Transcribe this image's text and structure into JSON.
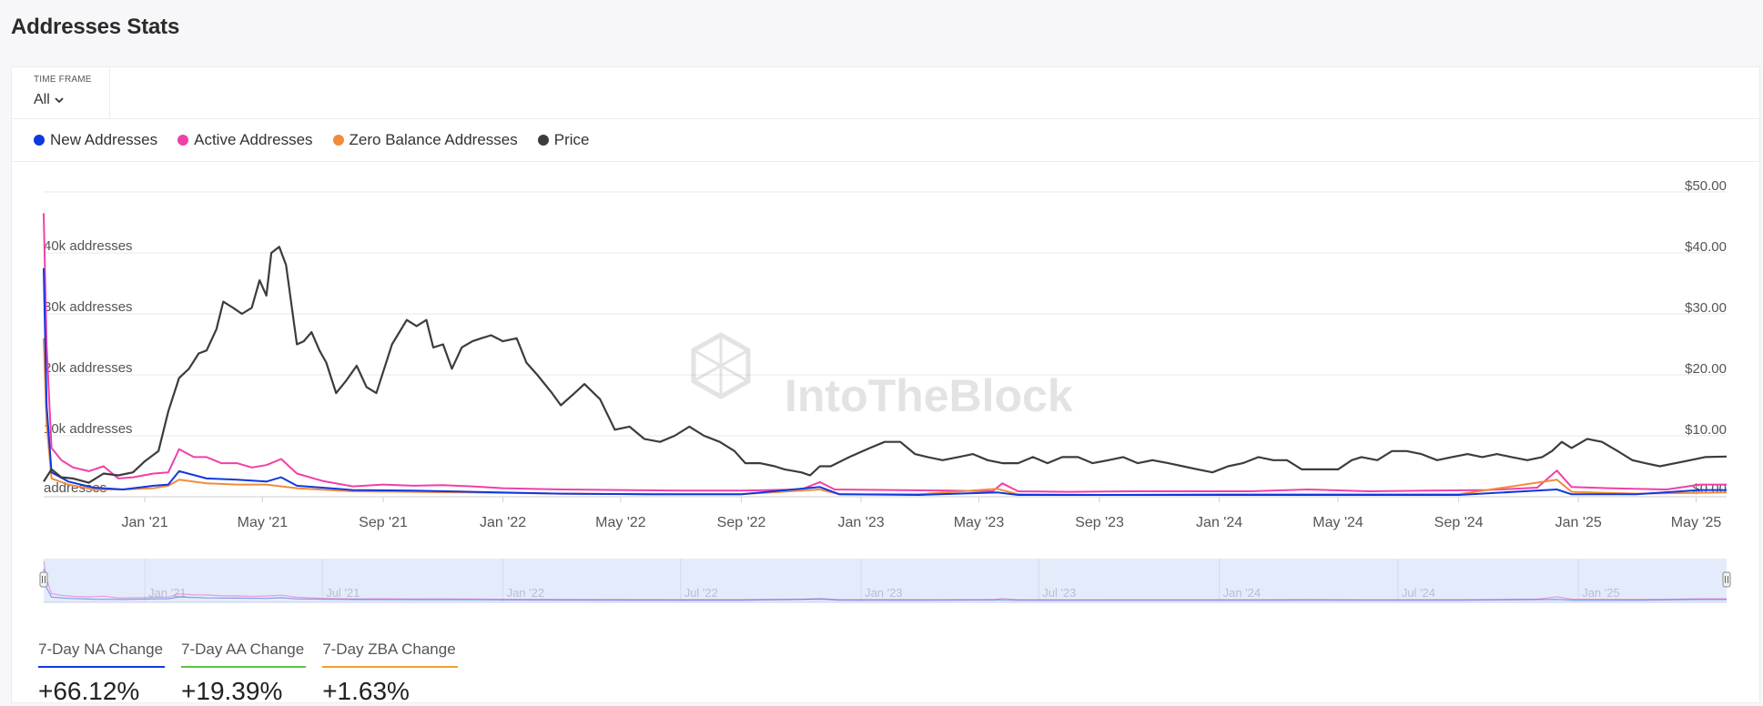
{
  "page": {
    "title": "Addresses Stats"
  },
  "timeframe": {
    "label": "TIME FRAME",
    "value": "All"
  },
  "legend": [
    {
      "label": "New Addresses",
      "color": "#1038e0"
    },
    {
      "label": "Active Addresses",
      "color": "#f040a8"
    },
    {
      "label": "Zero Balance Addresses",
      "color": "#f08c3c"
    },
    {
      "label": "Price",
      "color": "#3c3c3c"
    }
  ],
  "watermark": "IntoTheBlock",
  "navigator": {
    "labels": [
      "Jan '21",
      "Jul '21",
      "Jan '22",
      "Jul '22",
      "Jan '23",
      "Jul '23",
      "Jan '24",
      "Jul '24",
      "Jan '25"
    ]
  },
  "stats": [
    {
      "label": "7-Day NA Change",
      "value": "+66.12%",
      "color": "#1038e0"
    },
    {
      "label": "7-Day AA Change",
      "value": "+19.39%",
      "color": "#5cc24a"
    },
    {
      "label": "7-Day ZBA Change",
      "value": "+1.63%",
      "color": "#f0a030"
    }
  ],
  "chart_data": {
    "type": "line",
    "x_tick_labels": [
      "Jan '21",
      "May '21",
      "Sep '21",
      "Jan '22",
      "May '22",
      "Sep '22",
      "Jan '23",
      "May '23",
      "Sep '23",
      "Jan '24",
      "May '24",
      "Sep '24",
      "Jan '25",
      "May '25"
    ],
    "y_left_tick_labels": [
      "addresses",
      "10k addresses",
      "20k addresses",
      "30k addresses",
      "40k addresses"
    ],
    "y_left_range": [
      0,
      45000
    ],
    "y_right_tick_labels": [
      "$0.00",
      "$10.00",
      "$20.00",
      "$30.00",
      "$40.00",
      "$50.00"
    ],
    "y_right_range": [
      0,
      50
    ],
    "x_range": [
      "2020-09-20",
      "2025-06-01"
    ],
    "grid": true,
    "legend_position": "top-left",
    "series": [
      {
        "name": "Price",
        "axis": "right",
        "color": "#3c3c3c",
        "points": [
          [
            "2020-09-20",
            2.5
          ],
          [
            "2020-09-28",
            4.5
          ],
          [
            "2020-10-08",
            3.2
          ],
          [
            "2020-10-20",
            3.0
          ],
          [
            "2020-11-05",
            2.3
          ],
          [
            "2020-11-20",
            3.8
          ],
          [
            "2020-12-05",
            3.5
          ],
          [
            "2020-12-20",
            4.0
          ],
          [
            "2021-01-01",
            5.8
          ],
          [
            "2021-01-15",
            7.5
          ],
          [
            "2021-01-25",
            14.0
          ],
          [
            "2021-02-05",
            19.5
          ],
          [
            "2021-02-15",
            21.0
          ],
          [
            "2021-02-25",
            23.5
          ],
          [
            "2021-03-05",
            24.0
          ],
          [
            "2021-03-15",
            27.5
          ],
          [
            "2021-03-22",
            32.0
          ],
          [
            "2021-04-01",
            31.0
          ],
          [
            "2021-04-10",
            30.0
          ],
          [
            "2021-04-20",
            31.0
          ],
          [
            "2021-04-28",
            35.5
          ],
          [
            "2021-05-05",
            33.0
          ],
          [
            "2021-05-10",
            40.0
          ],
          [
            "2021-05-18",
            41.0
          ],
          [
            "2021-05-25",
            38.0
          ],
          [
            "2021-06-05",
            25.0
          ],
          [
            "2021-06-12",
            25.5
          ],
          [
            "2021-06-20",
            27.0
          ],
          [
            "2021-06-28",
            24.0
          ],
          [
            "2021-07-05",
            22.0
          ],
          [
            "2021-07-15",
            17.0
          ],
          [
            "2021-07-25",
            19.0
          ],
          [
            "2021-08-05",
            21.5
          ],
          [
            "2021-08-15",
            18.0
          ],
          [
            "2021-08-25",
            17.0
          ],
          [
            "2021-09-10",
            25.0
          ],
          [
            "2021-09-25",
            29.0
          ],
          [
            "2021-10-05",
            28.0
          ],
          [
            "2021-10-15",
            29.0
          ],
          [
            "2021-10-22",
            24.5
          ],
          [
            "2021-11-01",
            25.0
          ],
          [
            "2021-11-10",
            21.0
          ],
          [
            "2021-11-20",
            24.5
          ],
          [
            "2021-12-01",
            25.5
          ],
          [
            "2021-12-10",
            26.0
          ],
          [
            "2021-12-20",
            26.5
          ],
          [
            "2022-01-01",
            25.5
          ],
          [
            "2022-01-15",
            26.0
          ],
          [
            "2022-01-25",
            22.0
          ],
          [
            "2022-02-05",
            20.0
          ],
          [
            "2022-02-20",
            17.0
          ],
          [
            "2022-03-01",
            15.0
          ],
          [
            "2022-03-15",
            17.0
          ],
          [
            "2022-03-25",
            18.5
          ],
          [
            "2022-04-10",
            16.0
          ],
          [
            "2022-04-25",
            11.0
          ],
          [
            "2022-05-10",
            11.5
          ],
          [
            "2022-05-25",
            9.5
          ],
          [
            "2022-06-10",
            9.0
          ],
          [
            "2022-06-25",
            10.0
          ],
          [
            "2022-07-10",
            11.5
          ],
          [
            "2022-07-25",
            10.0
          ],
          [
            "2022-08-10",
            9.0
          ],
          [
            "2022-08-25",
            7.5
          ],
          [
            "2022-09-05",
            5.5
          ],
          [
            "2022-09-20",
            5.5
          ],
          [
            "2022-10-05",
            5.0
          ],
          [
            "2022-10-15",
            4.5
          ],
          [
            "2022-11-01",
            4.0
          ],
          [
            "2022-11-10",
            3.5
          ],
          [
            "2022-11-20",
            5.0
          ],
          [
            "2022-12-01",
            5.0
          ],
          [
            "2022-12-20",
            6.5
          ],
          [
            "2023-01-10",
            8.0
          ],
          [
            "2023-01-25",
            9.0
          ],
          [
            "2023-02-10",
            9.0
          ],
          [
            "2023-02-25",
            7.0
          ],
          [
            "2023-03-10",
            6.5
          ],
          [
            "2023-03-25",
            6.0
          ],
          [
            "2023-04-10",
            6.5
          ],
          [
            "2023-04-25",
            7.0
          ],
          [
            "2023-05-10",
            6.0
          ],
          [
            "2023-05-25",
            5.5
          ],
          [
            "2023-06-10",
            5.5
          ],
          [
            "2023-06-25",
            6.5
          ],
          [
            "2023-07-10",
            5.5
          ],
          [
            "2023-07-25",
            6.5
          ],
          [
            "2023-08-10",
            6.5
          ],
          [
            "2023-08-25",
            5.5
          ],
          [
            "2023-09-10",
            6.0
          ],
          [
            "2023-09-25",
            6.5
          ],
          [
            "2023-10-10",
            5.5
          ],
          [
            "2023-10-25",
            6.0
          ],
          [
            "2023-11-10",
            5.5
          ],
          [
            "2023-11-25",
            5.0
          ],
          [
            "2023-12-10",
            4.5
          ],
          [
            "2023-12-25",
            4.0
          ],
          [
            "2024-01-10",
            5.0
          ],
          [
            "2024-01-25",
            5.5
          ],
          [
            "2024-02-10",
            6.5
          ],
          [
            "2024-02-25",
            6.0
          ],
          [
            "2024-03-10",
            6.0
          ],
          [
            "2024-03-25",
            4.5
          ],
          [
            "2024-04-10",
            4.5
          ],
          [
            "2024-04-20",
            4.5
          ],
          [
            "2024-05-01",
            4.5
          ],
          [
            "2024-05-15",
            6.0
          ],
          [
            "2024-05-25",
            6.5
          ],
          [
            "2024-06-10",
            6.0
          ],
          [
            "2024-06-25",
            7.5
          ],
          [
            "2024-07-10",
            7.5
          ],
          [
            "2024-07-25",
            7.0
          ],
          [
            "2024-08-10",
            6.0
          ],
          [
            "2024-08-25",
            6.5
          ],
          [
            "2024-09-10",
            7.0
          ],
          [
            "2024-09-25",
            6.5
          ],
          [
            "2024-10-10",
            7.0
          ],
          [
            "2024-10-25",
            6.5
          ],
          [
            "2024-11-10",
            6.0
          ],
          [
            "2024-11-25",
            6.5
          ],
          [
            "2024-12-05",
            7.5
          ],
          [
            "2024-12-15",
            9.0
          ],
          [
            "2024-12-25",
            8.0
          ],
          [
            "2025-01-10",
            9.5
          ],
          [
            "2025-01-25",
            9.0
          ],
          [
            "2025-02-10",
            7.5
          ],
          [
            "2025-02-25",
            6.0
          ],
          [
            "2025-03-10",
            5.5
          ],
          [
            "2025-03-25",
            5.0
          ],
          [
            "2025-04-10",
            5.5
          ],
          [
            "2025-04-25",
            6.0
          ],
          [
            "2025-05-10",
            6.5
          ],
          [
            "2025-06-01",
            6.6
          ]
        ]
      },
      {
        "name": "Active Addresses",
        "axis": "left",
        "color": "#f040a8",
        "points": [
          [
            "2020-09-20",
            46500
          ],
          [
            "2020-09-23",
            25000
          ],
          [
            "2020-09-28",
            8000
          ],
          [
            "2020-10-08",
            6000
          ],
          [
            "2020-10-20",
            4800
          ],
          [
            "2020-11-05",
            4200
          ],
          [
            "2020-11-20",
            5000
          ],
          [
            "2020-12-05",
            3000
          ],
          [
            "2020-12-20",
            3200
          ],
          [
            "2021-01-10",
            3800
          ],
          [
            "2021-01-25",
            4000
          ],
          [
            "2021-02-05",
            7800
          ],
          [
            "2021-02-20",
            6500
          ],
          [
            "2021-03-05",
            6500
          ],
          [
            "2021-03-20",
            5500
          ],
          [
            "2021-04-05",
            5500
          ],
          [
            "2021-04-20",
            4800
          ],
          [
            "2021-05-05",
            5200
          ],
          [
            "2021-05-20",
            6200
          ],
          [
            "2021-06-05",
            3800
          ],
          [
            "2021-07-01",
            2600
          ],
          [
            "2021-08-01",
            1700
          ],
          [
            "2021-09-01",
            2000
          ],
          [
            "2021-10-01",
            1800
          ],
          [
            "2021-11-01",
            1900
          ],
          [
            "2021-12-01",
            1700
          ],
          [
            "2022-01-01",
            1400
          ],
          [
            "2022-03-01",
            1200
          ],
          [
            "2022-05-01",
            1100
          ],
          [
            "2022-07-01",
            1000
          ],
          [
            "2022-09-01",
            1000
          ],
          [
            "2022-11-01",
            1200
          ],
          [
            "2022-11-20",
            2400
          ],
          [
            "2022-12-05",
            1200
          ],
          [
            "2023-02-01",
            1100
          ],
          [
            "2023-04-01",
            1000
          ],
          [
            "2023-05-15",
            900
          ],
          [
            "2023-05-25",
            2200
          ],
          [
            "2023-06-10",
            900
          ],
          [
            "2023-08-01",
            800
          ],
          [
            "2023-10-01",
            900
          ],
          [
            "2023-12-01",
            900
          ],
          [
            "2024-02-01",
            900
          ],
          [
            "2024-04-01",
            1200
          ],
          [
            "2024-06-01",
            900
          ],
          [
            "2024-08-01",
            1000
          ],
          [
            "2024-10-01",
            1100
          ],
          [
            "2024-11-20",
            1500
          ],
          [
            "2024-12-10",
            4300
          ],
          [
            "2024-12-25",
            1600
          ],
          [
            "2025-02-01",
            1400
          ],
          [
            "2025-04-01",
            1200
          ],
          [
            "2025-05-05",
            2000
          ],
          [
            "2025-06-01",
            2000
          ]
        ]
      },
      {
        "name": "Zero Balance Addresses",
        "axis": "left",
        "color": "#f08c3c",
        "points": [
          [
            "2020-09-20",
            26000
          ],
          [
            "2020-09-23",
            12000
          ],
          [
            "2020-09-28",
            3000
          ],
          [
            "2020-10-15",
            2000
          ],
          [
            "2020-11-10",
            1200
          ],
          [
            "2020-12-10",
            1200
          ],
          [
            "2021-01-10",
            1400
          ],
          [
            "2021-01-25",
            1800
          ],
          [
            "2021-02-05",
            2800
          ],
          [
            "2021-03-05",
            2200
          ],
          [
            "2021-04-05",
            2000
          ],
          [
            "2021-05-05",
            2000
          ],
          [
            "2021-06-05",
            1400
          ],
          [
            "2021-08-01",
            900
          ],
          [
            "2021-10-01",
            800
          ],
          [
            "2021-12-01",
            700
          ],
          [
            "2022-03-01",
            500
          ],
          [
            "2022-06-01",
            400
          ],
          [
            "2022-09-01",
            400
          ],
          [
            "2022-11-20",
            1200
          ],
          [
            "2022-12-10",
            400
          ],
          [
            "2023-03-01",
            400
          ],
          [
            "2023-05-20",
            1300
          ],
          [
            "2023-06-10",
            400
          ],
          [
            "2023-09-01",
            300
          ],
          [
            "2024-01-01",
            400
          ],
          [
            "2024-05-01",
            400
          ],
          [
            "2024-09-01",
            400
          ],
          [
            "2024-12-10",
            2800
          ],
          [
            "2024-12-25",
            800
          ],
          [
            "2025-03-01",
            500
          ],
          [
            "2025-06-01",
            700
          ]
        ]
      },
      {
        "name": "New Addresses",
        "axis": "left",
        "color": "#1038e0",
        "points": [
          [
            "2020-09-20",
            37500
          ],
          [
            "2020-09-23",
            15000
          ],
          [
            "2020-09-28",
            4000
          ],
          [
            "2020-10-15",
            2500
          ],
          [
            "2020-11-10",
            1500
          ],
          [
            "2020-12-10",
            1200
          ],
          [
            "2021-01-10",
            1800
          ],
          [
            "2021-01-25",
            2000
          ],
          [
            "2021-02-05",
            4200
          ],
          [
            "2021-03-05",
            3000
          ],
          [
            "2021-04-05",
            2800
          ],
          [
            "2021-05-05",
            2500
          ],
          [
            "2021-05-20",
            3200
          ],
          [
            "2021-06-05",
            1800
          ],
          [
            "2021-08-01",
            1100
          ],
          [
            "2021-10-01",
            1000
          ],
          [
            "2021-12-01",
            800
          ],
          [
            "2022-03-01",
            500
          ],
          [
            "2022-06-01",
            400
          ],
          [
            "2022-09-01",
            400
          ],
          [
            "2022-11-20",
            1600
          ],
          [
            "2022-12-10",
            400
          ],
          [
            "2023-03-01",
            300
          ],
          [
            "2023-05-20",
            700
          ],
          [
            "2023-06-10",
            300
          ],
          [
            "2023-09-01",
            300
          ],
          [
            "2024-01-01",
            300
          ],
          [
            "2024-05-01",
            300
          ],
          [
            "2024-09-01",
            300
          ],
          [
            "2024-12-10",
            1200
          ],
          [
            "2024-12-25",
            400
          ],
          [
            "2025-03-01",
            400
          ],
          [
            "2025-05-05",
            1100
          ],
          [
            "2025-06-01",
            1100
          ]
        ]
      }
    ]
  }
}
